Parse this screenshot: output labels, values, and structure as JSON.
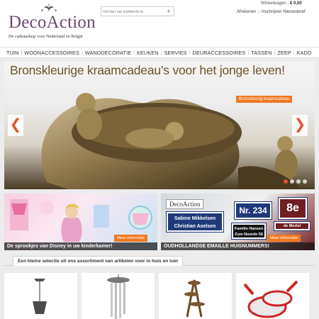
{
  "header": {
    "logo_text": "DecoAction",
    "tagline": "De cadeaushop voor Nederland en België",
    "search_placeholder": "Vul hier uw zoekterm in",
    "search_button": "+",
    "cart_label": "Winkelwagen",
    "cart_sep": "-",
    "cart_amount": "€ 0,00",
    "links": [
      "Afrekenen",
      "Inschrijven Nieuwsbrief"
    ]
  },
  "nav": {
    "items": [
      "TUIN",
      "WOONACCESSOIRES",
      "WANDDECORATIE",
      "KEUKEN",
      "SERVIES",
      "DEURACCESSOIRES",
      "TASSEN",
      "ZEEP",
      "KADO"
    ]
  },
  "slider": {
    "title": "Bronskleurige kraamcadeau’s voor het jonge leven!",
    "badge": "Bronskleurig kraamcadeau",
    "prev": "❮",
    "next": "❯",
    "active_slide": 1,
    "slide_count": 4
  },
  "banners": [
    {
      "caption": "De sprookjes van Disney in uw kinderkamer!",
      "button": "Meer informatie"
    },
    {
      "caption": "OUDHOLLANDSE EMAILLE HUISNUMMERS!",
      "button": "Meer informatie",
      "logo": "DecoAction",
      "plates": [
        "Sabine Mikkelsen",
        "Christian Axelsen",
        "Nr. 234",
        "Familie Hansen",
        "8e",
        "Zum Noorde 56",
        "de Mortel"
      ]
    }
  ],
  "section": {
    "title": "Een kleine selectie uit ons assortiment van artikelen voor in huis en tuin"
  },
  "colors": {
    "brand_purple": "#6b4a6b",
    "accent_orange": "#f07820",
    "title_bronze": "#6e5329"
  }
}
